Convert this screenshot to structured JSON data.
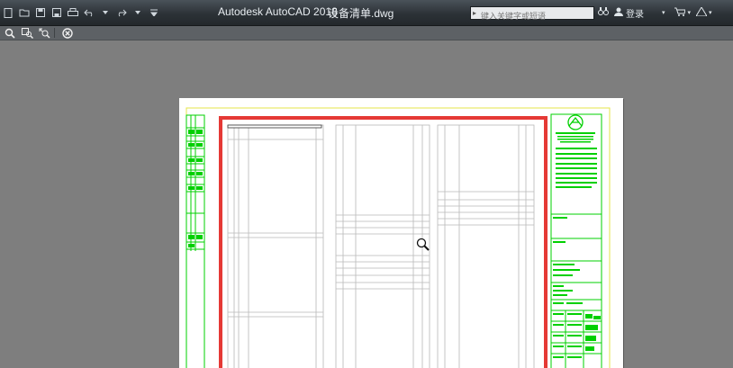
{
  "titlebar": {
    "app_title": "Autodesk AutoCAD 2018",
    "file_name": "设备清单.dwg",
    "search_placeholder": "键入关键字或短语",
    "login_label": "登录"
  },
  "quick_access": [
    "new-icon",
    "open-icon",
    "save-icon",
    "saveas-icon",
    "plot-icon",
    "undo-icon",
    "redo-icon",
    "dropdown-icon"
  ],
  "toolbar": [
    "zoom-realtime-icon",
    "zoom-window-icon",
    "zoom-previous-icon",
    "close-preview-icon"
  ],
  "colors": {
    "title_bar": "#2c3237",
    "toolbar": "#5d6165",
    "workspace": "#7e7e7e",
    "paper": "#ffffff",
    "outer_frame": "#e9e94a",
    "drawing_frame": "#e53935",
    "title_block": "#00d000",
    "table_lines": "#b5b5b5"
  }
}
